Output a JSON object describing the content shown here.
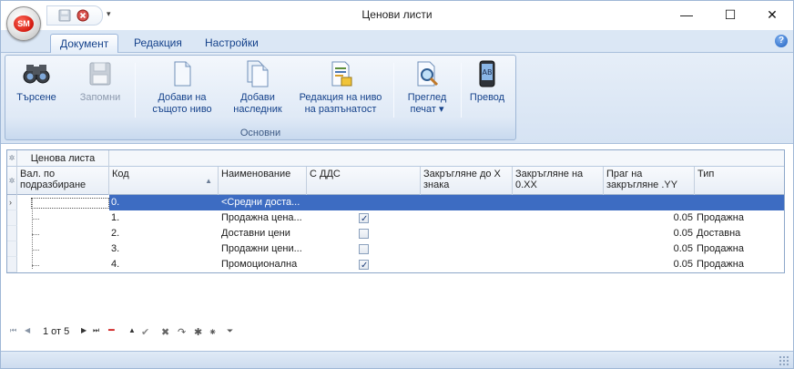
{
  "window": {
    "title": "Ценови листи",
    "app_badge": "SM",
    "minimize": "—",
    "maximize": "☐",
    "close": "✕"
  },
  "tabs": [
    {
      "label": "Документ",
      "active": true
    },
    {
      "label": "Редакция",
      "active": false
    },
    {
      "label": "Настройки",
      "active": false
    }
  ],
  "ribbon": {
    "group_label": "Основни",
    "buttons": {
      "search": {
        "line1": "Търсене",
        "line2": "",
        "icon": "binoculars-icon"
      },
      "save": {
        "line1": "Запомни",
        "line2": "",
        "icon": "floppy-disk-icon",
        "disabled": true
      },
      "add_same": {
        "line1": "Добави на",
        "line2": "същото ниво",
        "icon": "document-icon"
      },
      "add_child": {
        "line1": "Добави",
        "line2": "наследник",
        "icon": "documents-icon"
      },
      "edit_level": {
        "line1": "Редакция на ниво",
        "line2": "на разпънатост",
        "icon": "edit-document-icon"
      },
      "preview": {
        "line1": "Преглед",
        "line2": "печат ▾",
        "icon": "print-preview-icon"
      },
      "translate": {
        "line1": "Превод",
        "line2": "",
        "icon": "translate-icon"
      }
    }
  },
  "grid": {
    "band_label": "Ценова листа",
    "columns": {
      "default_currency": "Вал. по подразбиране",
      "code": "Код",
      "name": "Наименование",
      "vat": "С ДДС",
      "round_x": "Закръгляне до X знака",
      "round_xx": "Закръгляне на 0.XX",
      "threshold": "Праг на закръгляне .YY",
      "type": "Тип"
    },
    "rows": [
      {
        "code": "0.",
        "name": "<Средни доста...",
        "vat": null,
        "threshold": "",
        "type": ""
      },
      {
        "code": "1.",
        "name": "Продажна цена...",
        "vat": true,
        "threshold": "0.05",
        "type": "Продажна"
      },
      {
        "code": "2.",
        "name": "Доставни цени",
        "vat": false,
        "threshold": "0.05",
        "type": "Доставна"
      },
      {
        "code": "3.",
        "name": "Продажни цени...",
        "vat": false,
        "threshold": "0.05",
        "type": "Продажна"
      },
      {
        "code": "4.",
        "name": "Промоционална",
        "vat": true,
        "threshold": "0.05",
        "type": "Продажна"
      }
    ]
  },
  "navigator": {
    "record_text": "1 от 5"
  }
}
